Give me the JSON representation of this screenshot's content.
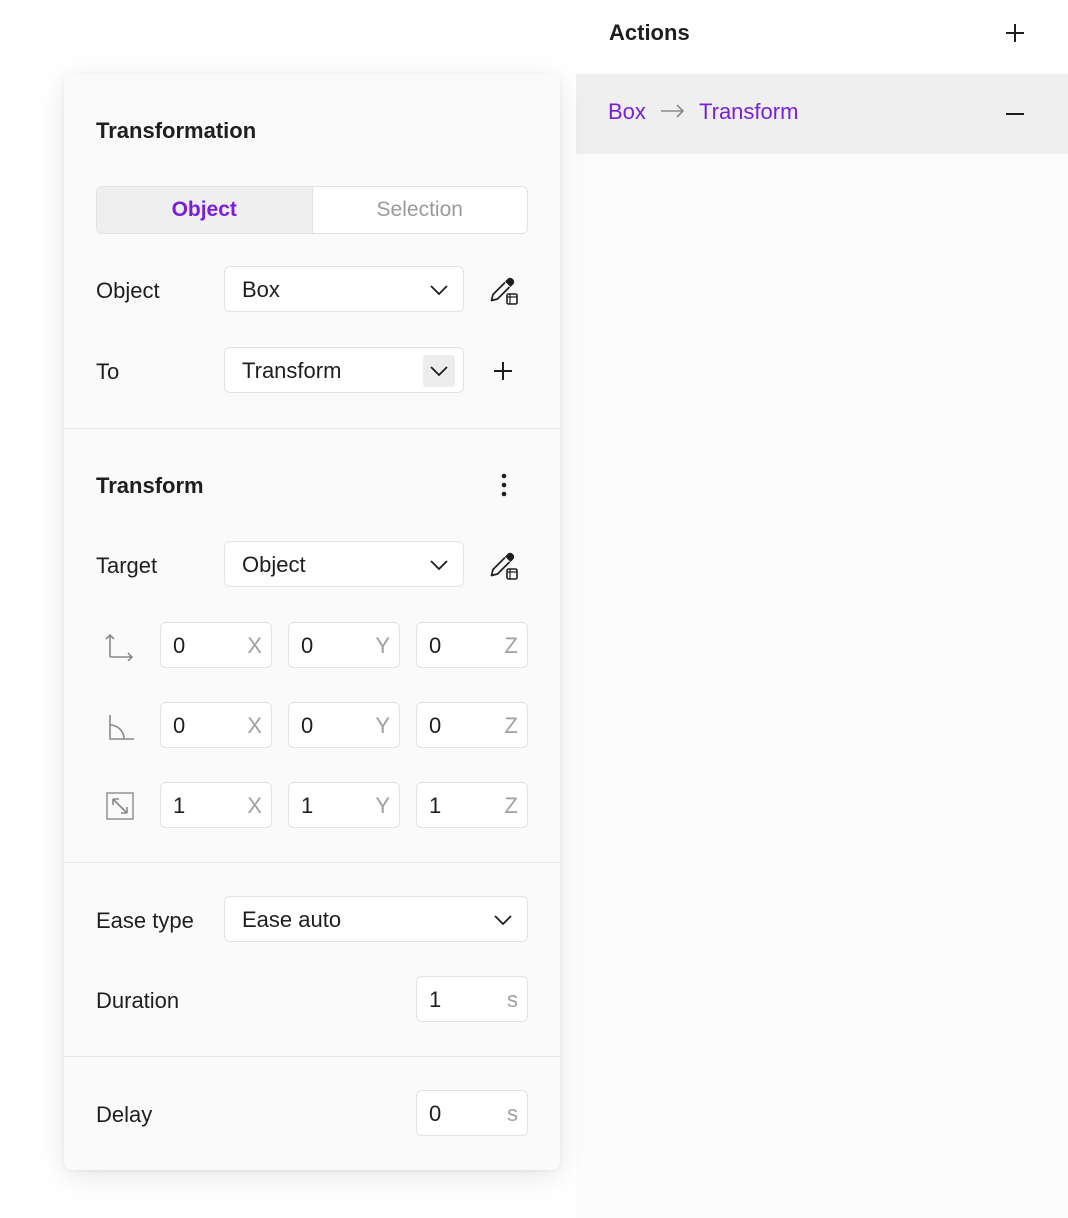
{
  "actions": {
    "title": "Actions",
    "add_icon": "plus-icon",
    "items": [
      {
        "from": "Box",
        "to": "Transform",
        "arrow_icon": "arrow-right-icon",
        "remove_icon": "minus-icon"
      }
    ]
  },
  "transformation": {
    "title": "Transformation",
    "tabs": [
      {
        "label": "Object",
        "active": true
      },
      {
        "label": "Selection",
        "active": false
      }
    ],
    "object": {
      "label": "Object",
      "value": "Box",
      "picker_icon": "eyedropper-icon"
    },
    "to": {
      "label": "To",
      "value": "Transform",
      "add_icon": "plus-icon"
    }
  },
  "transform": {
    "title": "Transform",
    "menu_icon": "more-vertical-icon",
    "target": {
      "label": "Target",
      "value": "Object",
      "picker_icon": "eyedropper-icon"
    },
    "position": {
      "icon": "position-axes-icon",
      "x": "0",
      "y": "0",
      "z": "0"
    },
    "rotation": {
      "icon": "rotation-angle-icon",
      "x": "0",
      "y": "0",
      "z": "0"
    },
    "scale": {
      "icon": "scale-icon",
      "x": "1",
      "y": "1",
      "z": "1"
    },
    "axis_labels": {
      "x": "X",
      "y": "Y",
      "z": "Z"
    }
  },
  "ease": {
    "label": "Ease type",
    "value": "Ease auto"
  },
  "duration": {
    "label": "Duration",
    "value": "1",
    "unit": "s"
  },
  "delay": {
    "label": "Delay",
    "value": "0",
    "unit": "s"
  },
  "colors": {
    "accent": "#7a1fd9",
    "panel_bg": "#fafafa",
    "row_highlight": "#efefef"
  }
}
